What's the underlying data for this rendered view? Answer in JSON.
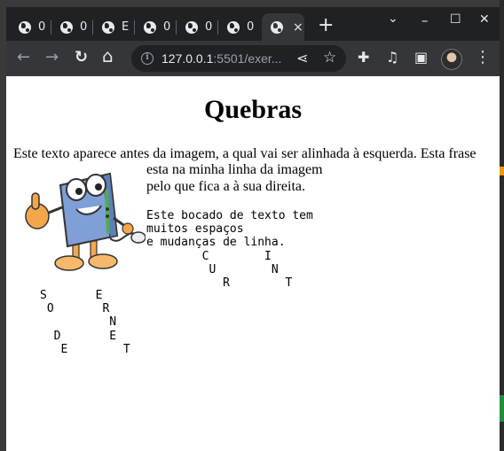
{
  "tabs": [
    {
      "label": "0"
    },
    {
      "label": "0"
    },
    {
      "label": "E"
    },
    {
      "label": "0"
    },
    {
      "label": "0"
    },
    {
      "label": "0"
    },
    {
      "label": "",
      "active": true,
      "close": "×"
    }
  ],
  "new_tab": "+",
  "window_controls": {
    "chevron": "⌄",
    "minimize": "–",
    "maximize": "☐",
    "close": "✕"
  },
  "toolbar": {
    "back": "←",
    "forward": "→",
    "reload": "↻",
    "home": "⌂",
    "url_host": "127.0.0.1",
    "url_rest": ":5501/exer...",
    "share": "⋖",
    "star": "☆",
    "extensions": "✚",
    "media": "♫",
    "sidepanel": "▣",
    "menu": "⋮"
  },
  "page": {
    "heading": "Quebras",
    "para_line1": "Este texto aparece antes da imagem, a qual vai ser alinhada à esquerda. Esta frase",
    "para_line2": "esta na minha linha da imagem",
    "para_line3": "pelo que fica a à sua direita.",
    "pre1": "Este bocado de texto tem\nmuitos espaços\ne mudanças de linha.\n        C        I\n         U        N\n           R        T",
    "pre2": "S       E\n O       R\n          N\n  D       E\n   E        T",
    "image_icon": "cartoon-computer-mascot"
  },
  "colors": {
    "chrome_dark": "#202124",
    "chrome_toolbar": "#35363a",
    "text_light": "#e8eaed",
    "page_bg": "#ffffff"
  }
}
